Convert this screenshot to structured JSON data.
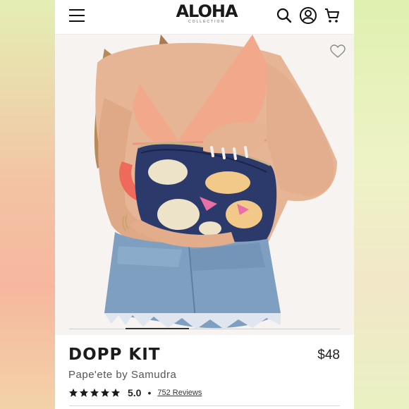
{
  "brand": {
    "logo_text": "ALOHA",
    "logo_sub": "COLLECTION"
  },
  "header": {
    "menu_icon": "hamburger-icon",
    "search_icon": "search-icon",
    "account_icon": "user-circle-icon",
    "cart_icon": "cart-icon"
  },
  "hero": {
    "wishlist_icon": "heart-outline-icon",
    "gallery_position": 0.2
  },
  "product": {
    "name": "DOPP KIT",
    "price": "$48",
    "variant": "Pape'ete by Samudra",
    "rating": "5.0",
    "rating_stars": 5,
    "separator": "•",
    "reviews_link": "752 Reviews"
  },
  "colors": {
    "bag_navy": "#2c3a6b",
    "bag_cream": "#ece3c8",
    "bag_yellow": "#f2c989",
    "bag_pink": "#e96fa6",
    "strap_coral": "#f06a5c",
    "bikini_peach": "#f2a88a",
    "denim": "#7f9fc0"
  }
}
